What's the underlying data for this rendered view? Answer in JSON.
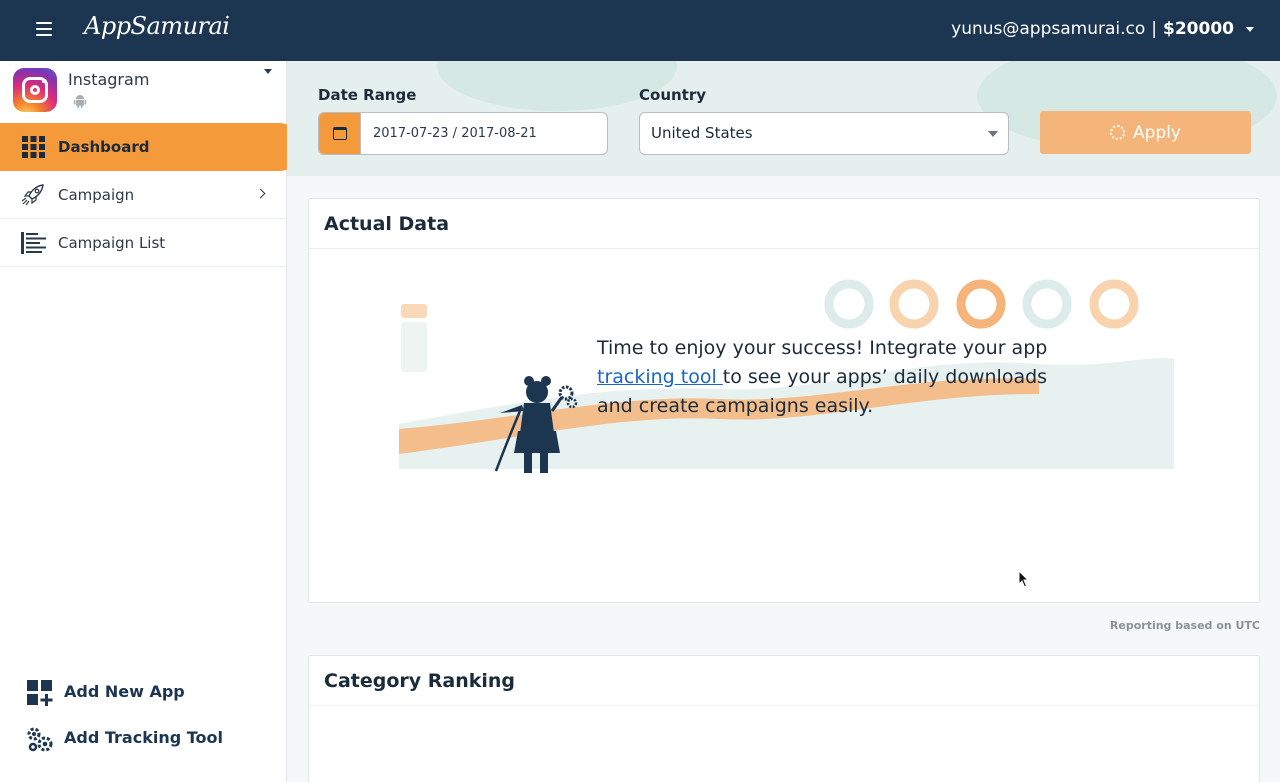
{
  "header": {
    "logo": "AppSamurai",
    "account_email": "yunus@appsamurai.co",
    "separator": "|",
    "balance": "$20000"
  },
  "sidebar": {
    "app_name": "Instagram",
    "platform_icon": "android-icon",
    "items": [
      {
        "label": "Dashboard",
        "icon": "grid-icon",
        "active": true
      },
      {
        "label": "Campaign",
        "icon": "rocket-icon",
        "has_submenu": true
      },
      {
        "label": "Campaign List",
        "icon": "list-icon"
      }
    ],
    "bottom": [
      {
        "label": "Add New App",
        "icon": "add-app-icon"
      },
      {
        "label": "Add Tracking Tool",
        "icon": "gears-icon"
      }
    ]
  },
  "filters": {
    "date_label": "Date Range",
    "date_value": "2017-07-23 / 2017-08-21",
    "country_label": "Country",
    "country_value": "United States",
    "apply_label": "Apply"
  },
  "actual_data": {
    "title": "Actual Data",
    "message_1": "Time to enjoy your success! Integrate your app",
    "link_text": "tracking tool ",
    "message_2": "to see your apps’ daily downloads",
    "message_3": "and create campaigns easily."
  },
  "reporting_note": "Reporting based on UTC",
  "category_ranking": {
    "title": "Category Ranking"
  },
  "colors": {
    "header_bg": "#1c3550",
    "accent": "#f59a3b",
    "filter_bg": "#e5f0ee",
    "link": "#1b65c4"
  }
}
